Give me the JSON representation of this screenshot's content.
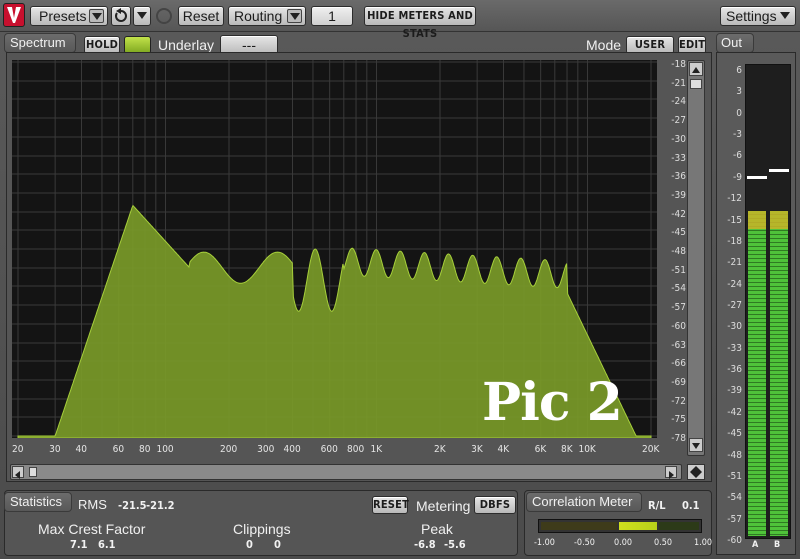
{
  "toolbar": {
    "presets_label": "Presets",
    "reset_label": "Reset",
    "routing_label": "Routing",
    "routing_value": "1",
    "hide_meters_label": "HIDE METERS AND STATS",
    "settings_label": "Settings"
  },
  "spectrum": {
    "tab_label": "Spectrum",
    "hold_label": "HOLD",
    "underlay_label": "Underlay",
    "underlay_value": "---",
    "mode_label": "Mode",
    "user_label": "USER",
    "edit_label": "EDIT",
    "overlay_text": "Pic 2",
    "fill_color": "#7a9a28",
    "y_ticks": [
      "-18",
      "-21",
      "-24",
      "-27",
      "-30",
      "-33",
      "-36",
      "-39",
      "-42",
      "-45",
      "-48",
      "-51",
      "-54",
      "-57",
      "-60",
      "-63",
      "-66",
      "-69",
      "-72",
      "-75",
      "-78"
    ],
    "x_ticks": [
      "20",
      "30",
      "40",
      "60",
      "80",
      "100",
      "200",
      "300",
      "400",
      "600",
      "800",
      "1K",
      "2K",
      "3K",
      "4K",
      "6K",
      "8K",
      "10K",
      "20K"
    ]
  },
  "out": {
    "label": "Out",
    "scale": [
      "6",
      "3",
      "0",
      "-3",
      "-6",
      "-9",
      "-12",
      "-15",
      "-18",
      "-21",
      "-24",
      "-27",
      "-30",
      "-33",
      "-36",
      "-39",
      "-42",
      "-45",
      "-48",
      "-51",
      "-54",
      "-57",
      "-60"
    ],
    "channel_a": "A",
    "channel_b": "B",
    "level_a_db": -14,
    "level_b_db": -14,
    "peak_a_db": -9,
    "peak_b_db": -8
  },
  "statistics": {
    "tab_label": "Statistics",
    "rms_label": "RMS",
    "rms_a": "-21.5",
    "rms_b": "-21.2",
    "reset_label": "RESET",
    "metering_label": "Metering",
    "metering_value": "DBFS",
    "max_crest_label": "Max Crest Factor",
    "crest_a": "7.1",
    "crest_b": "6.1",
    "clippings_label": "Clippings",
    "clip_a": "0",
    "clip_b": "0",
    "peak_label": "Peak",
    "peak_a": "-6.8",
    "peak_b": "-5.6"
  },
  "correlation": {
    "tab_label": "Correlation Meter",
    "rl_label": "R/L",
    "rl_value": "0.1",
    "ticks": [
      "-1.00",
      "-0.50",
      "0.00",
      "0.50",
      "1.00"
    ]
  }
}
